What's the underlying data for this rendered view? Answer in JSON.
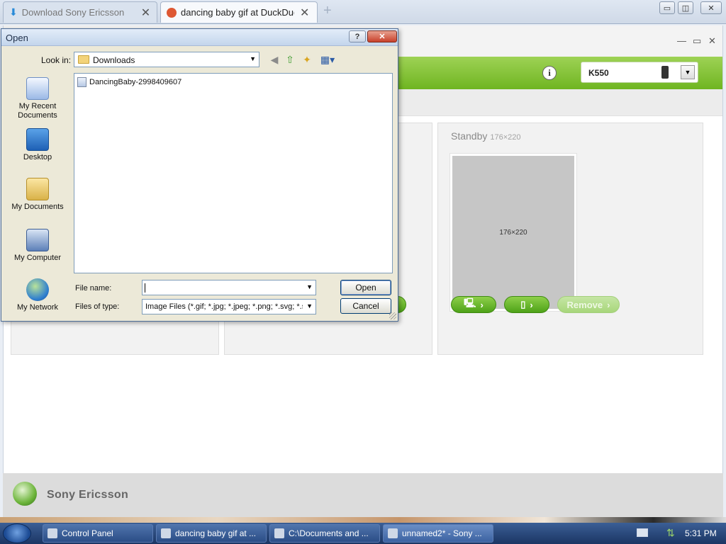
{
  "browser": {
    "tabs": [
      {
        "title": "Download Sony Ericsson",
        "active": false
      },
      {
        "title": "dancing baby gif at DuckDuckG",
        "active": true
      }
    ],
    "new_tab": "+",
    "controls": {
      "minimize": "▭",
      "restore": "◫",
      "close": "✕"
    }
  },
  "app": {
    "window_controls": {
      "minimize": "—",
      "restore": "▭",
      "close": "✕"
    },
    "info_label": "i",
    "device": {
      "name": "K550"
    },
    "panel_standby": {
      "title": "Standby",
      "dims": "176×220",
      "preview_text": "176×220"
    },
    "buttons": {
      "remove": "Remove"
    },
    "footer": {
      "brand": "Sony Ericsson"
    }
  },
  "dialog": {
    "title": "Open",
    "help": "?",
    "close": "✕",
    "look_in_label": "Look in:",
    "look_in_value": "Downloads",
    "places": [
      {
        "label": "My Recent Documents"
      },
      {
        "label": "Desktop"
      },
      {
        "label": "My Documents"
      },
      {
        "label": "My Computer"
      },
      {
        "label": "My Network"
      }
    ],
    "files": [
      {
        "name": "DancingBaby-2998409607"
      }
    ],
    "file_name_label": "File name:",
    "file_name_value": "",
    "file_type_label": "Files of type:",
    "file_type_value": "Image Files (*.gif; *.jpg; *.jpeg; *.png; *.svg; *.sv",
    "open_button": "Open",
    "cancel_button": "Cancel"
  },
  "taskbar": {
    "items": [
      {
        "label": "Control Panel",
        "active": false
      },
      {
        "label": "dancing baby gif at ...",
        "active": false
      },
      {
        "label": "C:\\Documents and ...",
        "active": false
      },
      {
        "label": "unnamed2* - Sony ...",
        "active": true
      }
    ],
    "clock": "5:31 PM"
  },
  "colors": {
    "accent_green": "#6fb521",
    "dialog_bg": "#ece9d8",
    "taskbar": "#1b3563"
  }
}
